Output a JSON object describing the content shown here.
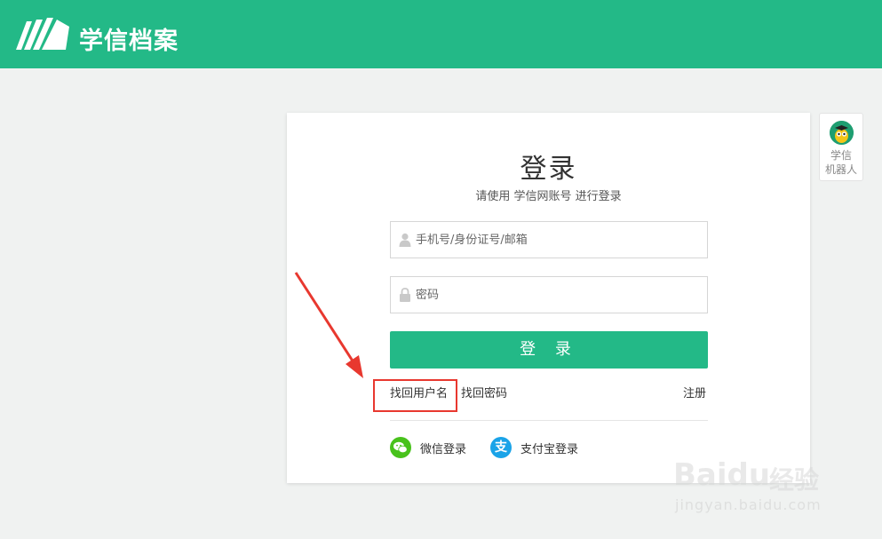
{
  "header": {
    "brand_name": "学信档案",
    "brand_color": "#23b987"
  },
  "login": {
    "title": "登录",
    "subtitle": "请使用 学信网账号 进行登录",
    "username_placeholder": "手机号/身份证号/邮箱",
    "password_placeholder": "密码",
    "submit_label": "登 录",
    "links": {
      "find_username": "找回用户名",
      "find_password": "找回密码",
      "register": "注册"
    },
    "social": {
      "wechat_label": "微信登录",
      "alipay_label": "支付宝登录",
      "alipay_glyph": "支"
    }
  },
  "robot": {
    "label_line1": "学信",
    "label_line2": "机器人"
  },
  "annotation": {
    "arrow_color": "#e8382f"
  },
  "watermark": {
    "brand": "Baidu",
    "suffix": "经验",
    "url": "jingyan.baidu.com"
  }
}
